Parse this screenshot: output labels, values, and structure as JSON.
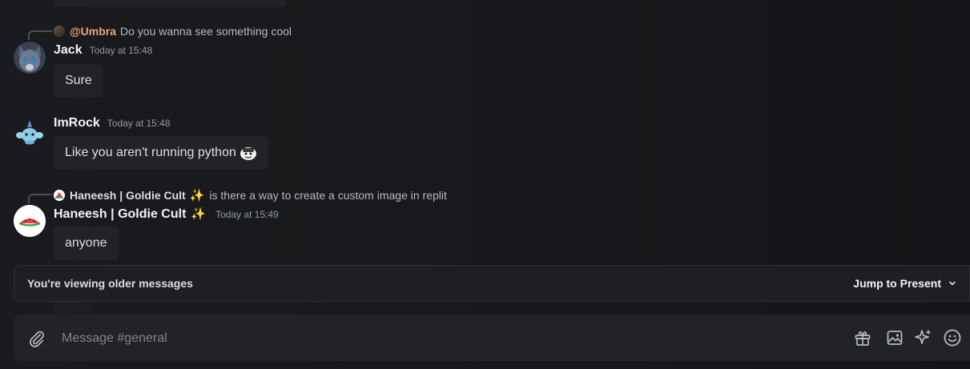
{
  "messages": [
    {
      "reply": {
        "user": "@Umbra",
        "text": "Do you wanna see something cool",
        "user_color": "#e8a27a"
      },
      "author": "Jack",
      "timestamp": "Today at 15:48",
      "content": "Sure"
    },
    {
      "author": "ImRock",
      "timestamp": "Today at 15:48",
      "content": "Like you aren't running python",
      "emoji": "custom-emoji-face"
    },
    {
      "reply": {
        "user": "Haneesh | Goldie Cult",
        "text": "is there a way to create a custom image in replit",
        "user_color": "#dbdee1"
      },
      "author": "Haneesh | Goldie Cult",
      "timestamp": "Today at 15:49",
      "content": "anyone"
    }
  ],
  "older_bar": {
    "text": "You're viewing older messages",
    "jump_label": "Jump to Present"
  },
  "composer": {
    "placeholder": "Message #general",
    "tools": [
      "gift-icon",
      "image-icon",
      "sparkle-icon",
      "emoji-icon"
    ]
  },
  "colors": {
    "background": "#1a1b1e",
    "bubble": "#222327",
    "timestamp": "#949ba4",
    "username": "#f2f3f5"
  }
}
